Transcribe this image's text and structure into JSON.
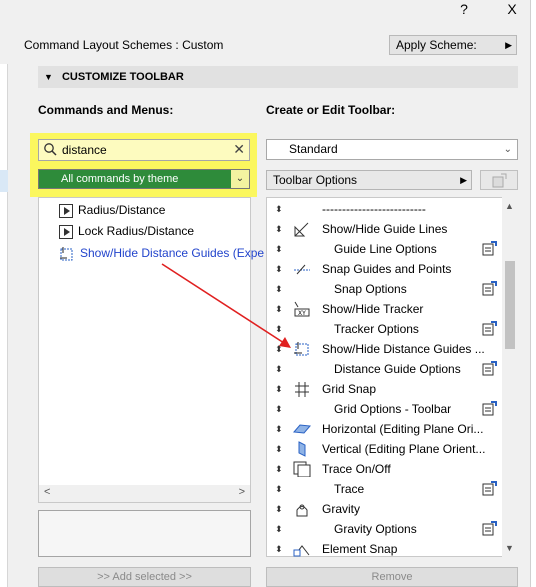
{
  "window": {
    "help_label": "?",
    "close_label": "X"
  },
  "header": {
    "scheme_label": "Command Layout Schemes : Custom",
    "apply_label": "Apply Scheme:"
  },
  "section": {
    "title": "CUSTOMIZE TOOLBAR"
  },
  "left": {
    "heading": "Commands and Menus:",
    "search": {
      "value": "distance",
      "placeholder": ""
    },
    "filter_label": "All commands by theme",
    "items": [
      {
        "label": "Radius/Distance"
      },
      {
        "label": "Lock Radius/Distance"
      },
      {
        "label": "Show/Hide Distance Guides (Expe"
      }
    ],
    "add_label": ">> Add selected >>"
  },
  "right": {
    "heading": "Create or Edit Toolbar:",
    "toolbar_select": "Standard",
    "options_label": "Toolbar Options",
    "items": [
      {
        "label": "--------------------------",
        "sub": false,
        "icon": "separator",
        "opt": false
      },
      {
        "label": "Show/Hide Guide Lines",
        "sub": false,
        "icon": "guide-lines-icon",
        "opt": false
      },
      {
        "label": "Guide Line Options",
        "sub": true,
        "icon": "",
        "opt": true
      },
      {
        "label": "Snap Guides and Points",
        "sub": false,
        "icon": "snap-guides-icon",
        "opt": false
      },
      {
        "label": "Snap Options",
        "sub": true,
        "icon": "",
        "opt": true
      },
      {
        "label": "Show/Hide Tracker",
        "sub": false,
        "icon": "tracker-icon",
        "opt": false
      },
      {
        "label": "Tracker Options",
        "sub": true,
        "icon": "",
        "opt": true
      },
      {
        "label": "Show/Hide Distance Guides ...",
        "sub": false,
        "icon": "distance-guides-icon",
        "opt": false
      },
      {
        "label": "Distance Guide Options",
        "sub": true,
        "icon": "",
        "opt": true
      },
      {
        "label": "Grid Snap",
        "sub": false,
        "icon": "grid-snap-icon",
        "opt": false
      },
      {
        "label": "Grid Options - Toolbar",
        "sub": true,
        "icon": "",
        "opt": true
      },
      {
        "label": "Horizontal (Editing Plane Ori...",
        "sub": false,
        "icon": "horizontal-plane-icon",
        "opt": false
      },
      {
        "label": "Vertical (Editing Plane Orient...",
        "sub": false,
        "icon": "vertical-plane-icon",
        "opt": false
      },
      {
        "label": "Trace On/Off",
        "sub": false,
        "icon": "trace-icon",
        "opt": false
      },
      {
        "label": "Trace",
        "sub": true,
        "icon": "",
        "opt": true
      },
      {
        "label": "Gravity",
        "sub": false,
        "icon": "gravity-icon",
        "opt": false
      },
      {
        "label": "Gravity Options",
        "sub": true,
        "icon": "",
        "opt": true
      },
      {
        "label": "Element Snap",
        "sub": false,
        "icon": "element-snap-icon",
        "opt": false
      }
    ],
    "remove_label": "Remove"
  },
  "colors": {
    "highlight": "#fbf75e",
    "filter_bg": "#2e8b3a",
    "link": "#2244cc",
    "arrow": "#e02020"
  }
}
